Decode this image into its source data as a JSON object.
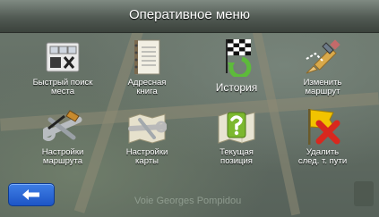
{
  "header": {
    "title": "Оперативное меню"
  },
  "menu": {
    "items": [
      {
        "label": "Быстрый поиск\nместа",
        "icon": "quick-search-icon"
      },
      {
        "label": "Адресная\nкнига",
        "icon": "address-book-icon"
      },
      {
        "label": "История",
        "icon": "history-icon"
      },
      {
        "label": "Изменить\nмаршрут",
        "icon": "edit-route-icon"
      },
      {
        "label": "Настройки\nмаршрута",
        "icon": "route-settings-icon"
      },
      {
        "label": "Настройки\nкарты",
        "icon": "map-settings-icon"
      },
      {
        "label": "Текущая\nпозиция",
        "icon": "current-position-icon"
      },
      {
        "label": "Удалить\nслед. т. пути",
        "icon": "delete-waypoint-icon"
      }
    ]
  },
  "bottom": {
    "street": "Voie Georges Pompidou",
    "back_icon": "back-arrow-icon"
  },
  "colors": {
    "accent_blue": "#2a65d8",
    "delete_red": "#d8281e",
    "flag_yellow": "#f2c300",
    "help_green": "#7cb82f"
  }
}
